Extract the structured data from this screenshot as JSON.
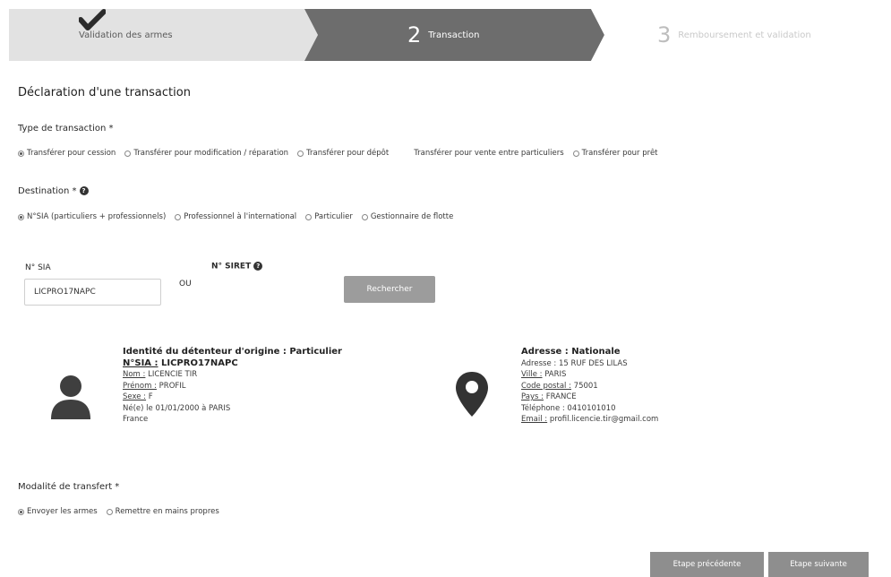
{
  "stepper": {
    "steps": [
      {
        "label": "Validation des armes",
        "state": "done"
      },
      {
        "number": "2",
        "label": "Transaction",
        "state": "active"
      },
      {
        "number": "3",
        "label": "Remboursement et validation",
        "state": "pending"
      }
    ],
    "colors": {
      "done": "#e2e2e2",
      "active": "#6d6d6d",
      "pending": "#ffffff"
    }
  },
  "page_title": "Déclaration d'une transaction",
  "transaction_type": {
    "label": "Type de transaction *",
    "options": [
      {
        "label": "Transférer pour cession",
        "checked": true
      },
      {
        "label": "Transférer pour modification / réparation",
        "checked": false
      },
      {
        "label": "Transférer pour dépôt",
        "checked": false
      },
      {
        "label": "Transférer pour vente entre particuliers",
        "checked": false
      },
      {
        "label": "Transférer pour prêt",
        "checked": false
      }
    ]
  },
  "destination": {
    "label": "Destination *",
    "options": [
      {
        "label": "N°SIA (particuliers + professionnels)",
        "checked": true
      },
      {
        "label": "Professionnel à l'international",
        "checked": false
      },
      {
        "label": "Particulier",
        "checked": false
      },
      {
        "label": "Gestionnaire de flotte",
        "checked": false
      }
    ]
  },
  "search": {
    "sia_label": "N° SIA",
    "sia_value": "LICPRO17NAPC",
    "or_label": "OU",
    "siret_label": "N° SIRET",
    "button_label": "Rechercher"
  },
  "identity": {
    "header": "Identité du détenteur d'origine : Particulier",
    "sia_key": "N°SIA :",
    "sia_value": "LICPRO17NAPC",
    "nom_key": "Nom :",
    "nom_value": "LICENCIE TIR",
    "prenom_key": "Prénom :",
    "prenom_value": "PROFIL",
    "sexe_key": "Sexe :",
    "sexe_value": "F",
    "birth_line": "Né(e) le 01/01/2000 à PARIS",
    "country": "France"
  },
  "address": {
    "header": "Adresse : Nationale",
    "adresse_line": "Adresse : 15 RUF DES LILAS",
    "ville_key": "Ville :",
    "ville_value": "PARIS",
    "cp_key": "Code postal :",
    "cp_value": "75001",
    "pays_key": "Pays :",
    "pays_value": "FRANCE",
    "tel_line": "Téléphone : 0410101010",
    "email_key": "Email :",
    "email_value": "profil.licencie.tir@gmail.com"
  },
  "transfer_mode": {
    "label": "Modalité de transfert *",
    "options": [
      {
        "label": "Envoyer les armes",
        "checked": true
      },
      {
        "label": "Remettre en mains propres",
        "checked": false
      }
    ]
  },
  "footer": {
    "prev_label": "Etape précédente",
    "next_label": "Etape suivante"
  }
}
